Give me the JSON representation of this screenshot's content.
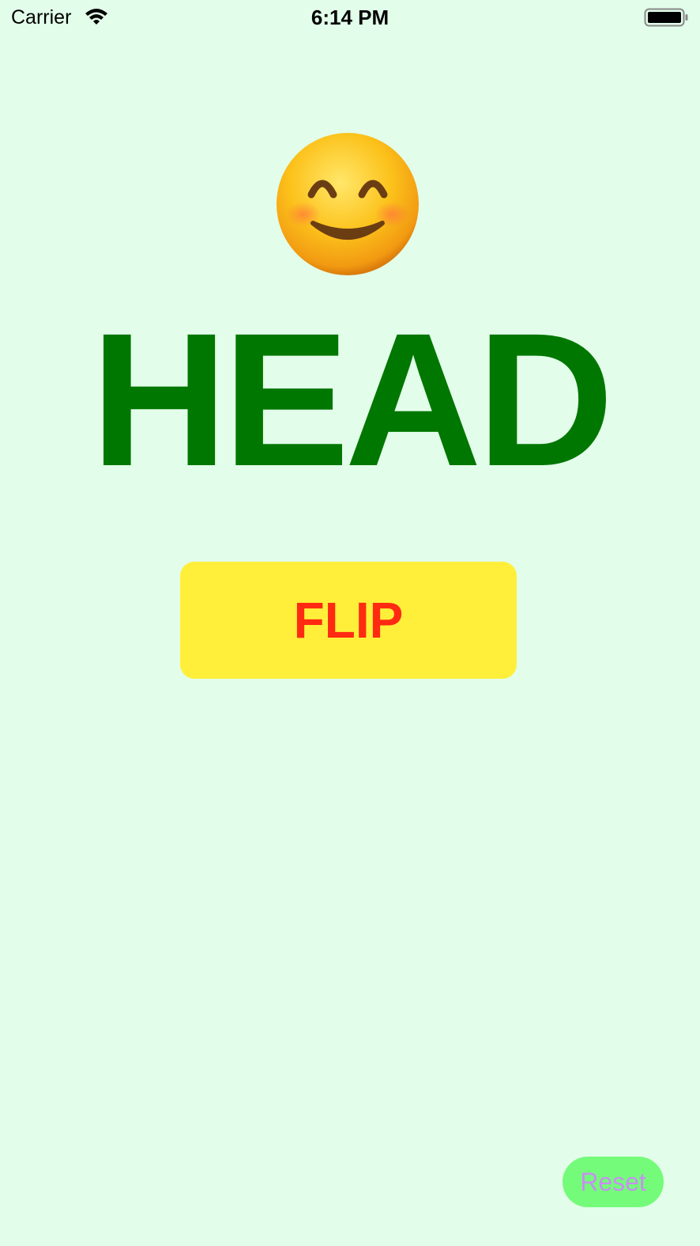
{
  "status_bar": {
    "carrier": "Carrier",
    "time": "6:14 PM",
    "wifi_icon": "wifi-icon",
    "battery_icon": "battery-icon"
  },
  "coin": {
    "face_icon": "smiling-face-icon",
    "result": "HEAD",
    "result_color": "#007700"
  },
  "actions": {
    "flip_label": "FLIP",
    "flip_bg": "#ffef3a",
    "flip_color": "#ff2a12",
    "reset_label": "Reset",
    "reset_bg": "#74fb7a",
    "reset_color": "#c98ef2"
  },
  "theme": {
    "background": "#e2fde9"
  }
}
